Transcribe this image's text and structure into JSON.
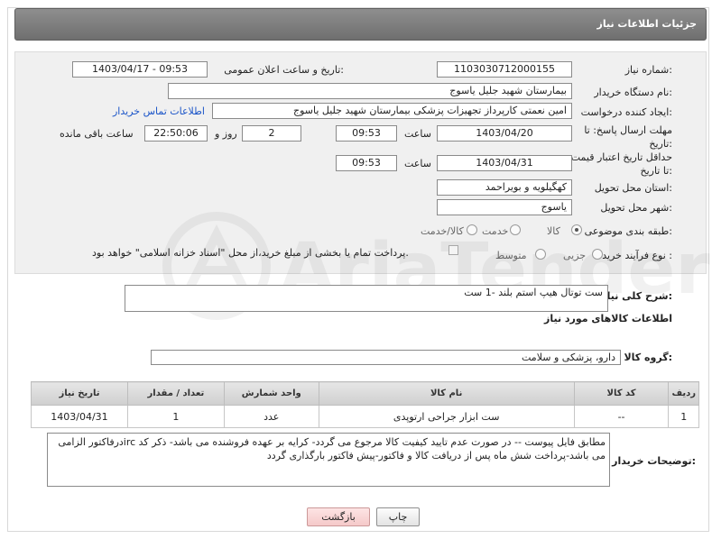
{
  "header": {
    "title": "جزئیات اطلاعات نیاز"
  },
  "form": {
    "need_number": {
      "label": "شماره نیاز:",
      "value": "1103030712000155"
    },
    "announce_datetime": {
      "label": "تاریخ و ساعت اعلان عمومی:",
      "value": "1403/04/17 - 09:53"
    },
    "buyer_org": {
      "label": "نام دستگاه خریدار:",
      "value": "بیمارستان شهید جلیل یاسوج"
    },
    "requester": {
      "label": "ایجاد کننده درخواست:",
      "value": "امین نعمتی کارپرداز تجهیزات پزشکی بیمارستان شهید جلیل یاسوج"
    },
    "buyer_contact_link": "اطلاعات تماس خریدار",
    "reply_deadline": {
      "label": "مهلت ارسال پاسخ: تا تاریخ:",
      "date": "1403/04/20",
      "time_label": "ساعت",
      "time": "09:53",
      "days": "2",
      "days_label": "روز و",
      "remaining": "22:50:06",
      "remaining_label": "ساعت باقی مانده"
    },
    "price_validity": {
      "label": "حداقل تاریخ اعتبار قیمت: تا تاریخ:",
      "date": "1403/04/31",
      "time_label": "ساعت",
      "time": "09:53"
    },
    "province": {
      "label": "استان محل تحویل:",
      "value": "کهگیلویه و بویراحمد"
    },
    "city": {
      "label": "شهر محل تحویل:",
      "value": "یاسوج"
    },
    "category": {
      "label": "طبقه بندی موضوعی:",
      "options": [
        "کالا",
        "خدمت",
        "کالا/خدمت"
      ],
      "selected": "کالا"
    },
    "purchase_type": {
      "label": "نوع فرآیند خرید :",
      "options": [
        "جزیی",
        "متوسط"
      ],
      "note": "پرداخت تمام یا بخشی از مبلغ خرید،از محل \"اسناد خزانه اسلامی\" خواهد بود."
    }
  },
  "description": {
    "label": "شرح کلی نیاز:",
    "value": "ست توتال هیپ استم بلند -1 ست"
  },
  "goods_section": {
    "title": "اطلاعات کالاهای مورد نیاز"
  },
  "goods_group": {
    "label": "گروه کالا:",
    "value": "دارو، پزشکی و سلامت"
  },
  "table": {
    "headers": [
      "ردیف",
      "کد کالا",
      "نام کالا",
      "واحد شمارش",
      "تعداد / مقدار",
      "تاریخ نیاز"
    ],
    "rows": [
      [
        "1",
        "--",
        "ست ابزار جراحی ارتوپدی",
        "عدد",
        "1",
        "1403/04/31"
      ]
    ]
  },
  "buyer_notes": {
    "label": "توضیحات خریدار:",
    "value": "مطابق فایل پیوست -- در صورت عدم تایید کیفیت کالا مرجوع می گردد- کرایه بر عهده فروشنده می باشد- ذکر کد ircدرفاکتور الزامی می باشد-پرداخت شش ماه پس از دریافت کالا و فاکتور-پیش فاکتور بارگذاری گردد"
  },
  "buttons": {
    "print": "چاپ",
    "back": "بازگشت"
  },
  "colors": {
    "title_bar": "#7a7a7a",
    "link": "#1a54c8",
    "panel": "#f0f0f0"
  }
}
